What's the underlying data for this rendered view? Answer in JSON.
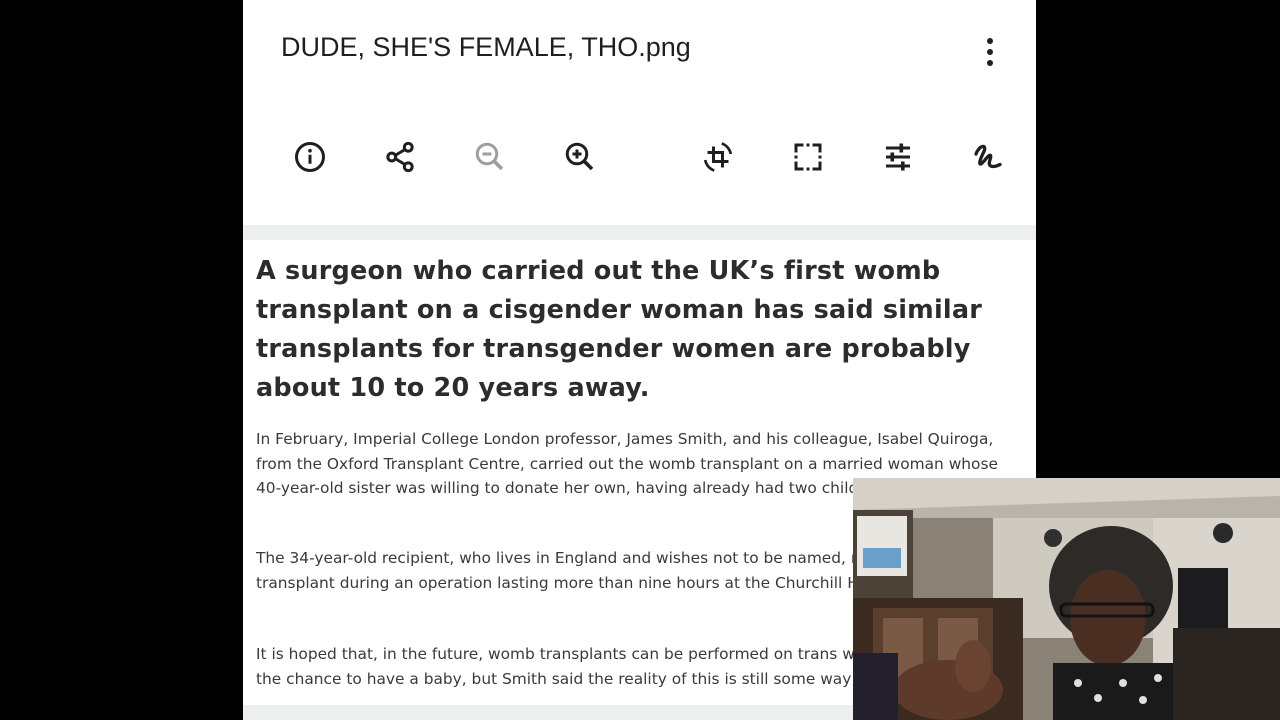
{
  "viewer": {
    "title": "DUDE, SHE'S FEMALE, THO.png",
    "more_icon": "more-vertical-icon"
  },
  "toolbar": {
    "tools": [
      {
        "name": "info",
        "icon": "info-icon"
      },
      {
        "name": "share",
        "icon": "share-icon"
      },
      {
        "name": "zoom-out",
        "icon": "zoom-out-icon",
        "disabled": true
      },
      {
        "name": "zoom-in",
        "icon": "zoom-in-icon"
      },
      {
        "name": "rotate-crop",
        "icon": "rotate-icon"
      },
      {
        "name": "crop",
        "icon": "crop-icon"
      },
      {
        "name": "adjust",
        "icon": "sliders-icon"
      },
      {
        "name": "markup",
        "icon": "draw-icon"
      }
    ]
  },
  "article": {
    "headline": "A surgeon who carried out the UK’s first womb transplant on a cisgender woman has said similar transplants for transgender women are probably about 10 to 20 years away.",
    "p1": "In February, Imperial College London professor, James Smith, and his colleague, Isabel Quiroga, from the Oxford Transplant Centre, carried out the womb transplant on a married woman whose 40-year-old sister was willing to donate her own, having already had two children.",
    "p2": "The 34-year-old recipient, who lives in England and wishes not to be named, received the transplant during an operation lasting more than nine hours at the Churchill Hospital in Oxford.",
    "p3": "It is hoped that, in the future, womb transplants can be performed on trans women, giving them the chance to have a baby, but Smith said the reality of this is still some way off."
  },
  "colors": {
    "page_bg": "#000000",
    "viewer_bg": "#ffffff",
    "icon": "#1f1f1f",
    "icon_disabled": "#9e9e9e",
    "headline": "#2c2c2c",
    "body": "#3a3a3a"
  }
}
